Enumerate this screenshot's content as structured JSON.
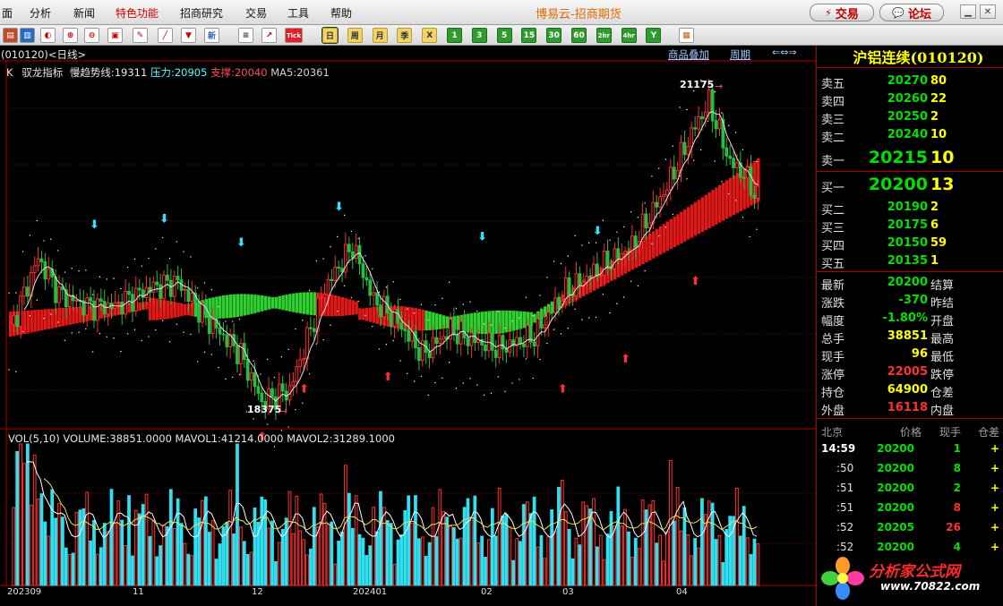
{
  "menu": {
    "items": [
      "面",
      "分析",
      "新闻",
      "特色功能",
      "招商研究",
      "交易",
      "工具",
      "帮助"
    ],
    "highlighted": "特色功能",
    "app_title": "博易云-招商期货",
    "trade_button": "交易",
    "forum_button": "论坛"
  },
  "toolbar": {
    "period_buttons": [
      "日",
      "周",
      "月",
      "季",
      "X",
      "1",
      "3",
      "5",
      "15",
      "30",
      "60",
      "2hr",
      "4hr",
      "Y"
    ],
    "active_period": "日"
  },
  "chart_header": {
    "symbol_tab": "(010120)<日线>",
    "overlay_link": "商品叠加",
    "period_link": "周期",
    "indicator_line": {
      "prefix": "K",
      "name": "驭龙指标",
      "slow_trend_label": "慢趋势线:19311",
      "pressure_label": "压力:20905",
      "support_label": "支撑:20040",
      "ma5_label": "MA5:20361"
    },
    "vol_line": "VOL(5,10) VOLUME:38851.0000 MAVOL1:41214.0000 MAVOL2:31289.1000"
  },
  "annotations": {
    "high": "21175",
    "low": "18375"
  },
  "x_axis": [
    "202309",
    "11",
    "12",
    "202401",
    "02",
    "03",
    "04"
  ],
  "quote": {
    "title": "沪铝连续(010120)",
    "asks": [
      {
        "label": "卖五",
        "price": "20270",
        "vol": "80"
      },
      {
        "label": "卖四",
        "price": "20260",
        "vol": "22"
      },
      {
        "label": "卖三",
        "price": "20250",
        "vol": "2"
      },
      {
        "label": "卖二",
        "price": "20240",
        "vol": "10"
      },
      {
        "label": "卖一",
        "price": "20215",
        "vol": "10"
      }
    ],
    "bids": [
      {
        "label": "买一",
        "price": "20200",
        "vol": "13"
      },
      {
        "label": "买二",
        "price": "20190",
        "vol": "2"
      },
      {
        "label": "买三",
        "price": "20175",
        "vol": "6"
      },
      {
        "label": "买四",
        "price": "20150",
        "vol": "59"
      },
      {
        "label": "买五",
        "price": "20135",
        "vol": "1"
      }
    ],
    "stats": [
      {
        "label": "最新",
        "value": "20200",
        "color": "#00e000",
        "label2": "结算"
      },
      {
        "label": "涨跌",
        "value": "-370",
        "color": "#00e000",
        "label2": "昨结"
      },
      {
        "label": "幅度",
        "value": "-1.80%",
        "color": "#00e000",
        "label2": "开盘"
      },
      {
        "label": "总手",
        "value": "38851",
        "color": "#ffff00",
        "label2": "最高"
      },
      {
        "label": "现手",
        "value": "96",
        "color": "#ffff00",
        "label2": "最低"
      },
      {
        "label": "涨停",
        "value": "22005",
        "color": "#ff3030",
        "label2": "跌停"
      },
      {
        "label": "持仓",
        "value": "64900",
        "color": "#ffff00",
        "label2": "仓差"
      },
      {
        "label": "外盘",
        "value": "16118",
        "color": "#ff3030",
        "label2": "内盘"
      }
    ],
    "tick_headers": {
      "place": "北京",
      "price": "价格",
      "vol": "现手",
      "oi": "仓差"
    },
    "ticks": [
      {
        "time": "14:59",
        "price": "20200",
        "vol": "1",
        "vol_color": "#00e000",
        "oi": "+"
      },
      {
        "time": ":50",
        "price": "20200",
        "vol": "8",
        "vol_color": "#00e000",
        "oi": "+"
      },
      {
        "time": ":51",
        "price": "20200",
        "vol": "2",
        "vol_color": "#00e000",
        "oi": "+"
      },
      {
        "time": ":51",
        "price": "20200",
        "vol": "8",
        "vol_color": "#ff3030",
        "oi": "+"
      },
      {
        "time": ":52",
        "price": "20205",
        "vol": "26",
        "vol_color": "#ff3030",
        "oi": "+"
      },
      {
        "time": ":52",
        "price": "20200",
        "vol": "4",
        "vol_color": "#00e000",
        "oi": "+"
      }
    ]
  },
  "watermark": {
    "text": "分析家公式网",
    "url": "www.70822.com"
  }
}
